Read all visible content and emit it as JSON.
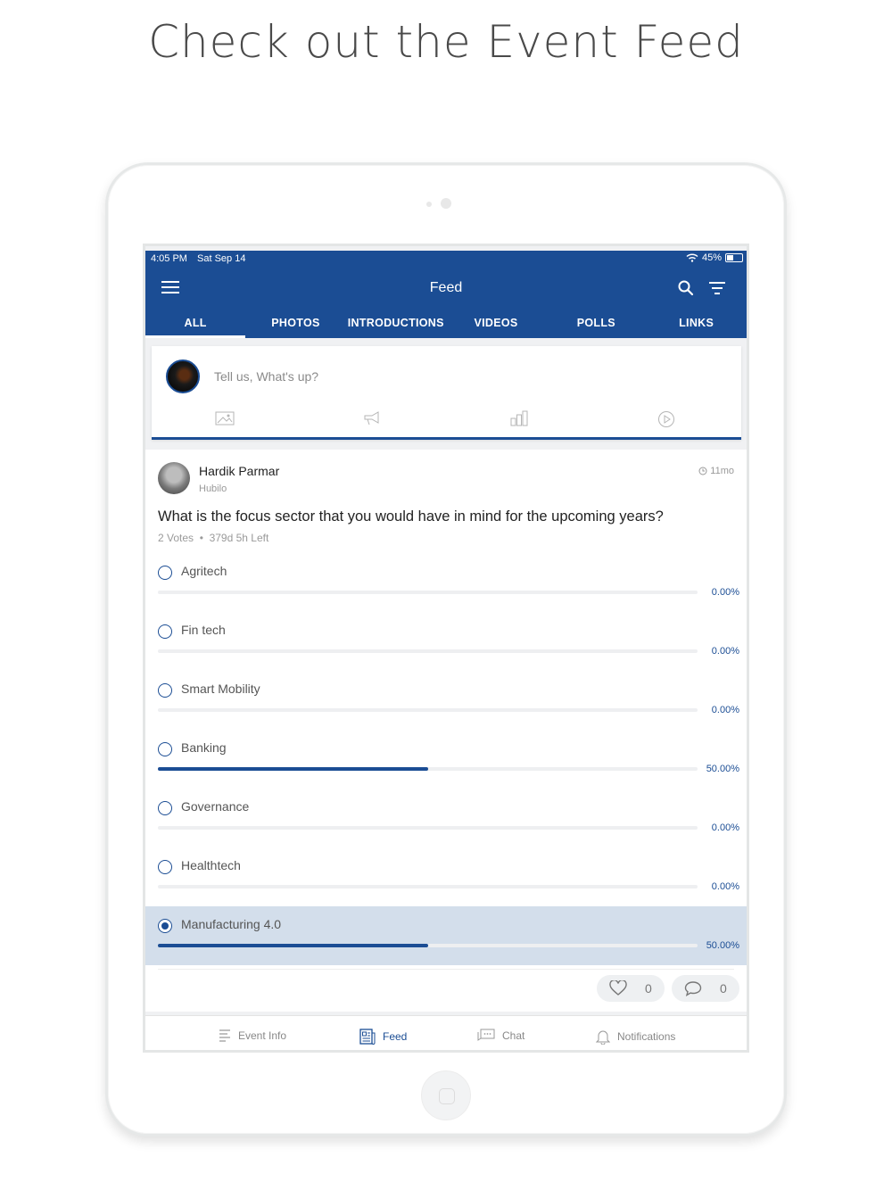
{
  "headline": "Check out the Event Feed",
  "status_bar": {
    "time": "4:05 PM",
    "date": "Sat Sep 14",
    "battery": "45%"
  },
  "header": {
    "title": "Feed"
  },
  "tabs": [
    {
      "label": "ALL",
      "active": true
    },
    {
      "label": "PHOTOS",
      "active": false
    },
    {
      "label": "INTRODUCTIONS",
      "active": false
    },
    {
      "label": "VIDEOS",
      "active": false
    },
    {
      "label": "POLLS",
      "active": false
    },
    {
      "label": "LINKS",
      "active": false
    }
  ],
  "composer": {
    "placeholder": "Tell us, What's up?",
    "actions": [
      "image-icon",
      "megaphone-icon",
      "poll-icon",
      "video-play-icon"
    ]
  },
  "post": {
    "author": "Hardik Parmar",
    "organization": "Hubilo",
    "time_ago": "11mo",
    "question": "What is the focus sector that you would have in mind for the upcoming years?",
    "votes": "2 Votes",
    "time_left": "379d 5h Left",
    "options": [
      {
        "label": "Agritech",
        "percent_label": "0.00%",
        "percent": 0,
        "selected": false
      },
      {
        "label": "Fin tech",
        "percent_label": "0.00%",
        "percent": 0,
        "selected": false
      },
      {
        "label": "Smart Mobility",
        "percent_label": "0.00%",
        "percent": 0,
        "selected": false
      },
      {
        "label": "Banking",
        "percent_label": "50.00%",
        "percent": 50,
        "selected": false
      },
      {
        "label": "Governance",
        "percent_label": "0.00%",
        "percent": 0,
        "selected": false
      },
      {
        "label": "Healthtech",
        "percent_label": "0.00%",
        "percent": 0,
        "selected": false
      },
      {
        "label": "Manufacturing 4.0",
        "percent_label": "50.00%",
        "percent": 50,
        "selected": true
      }
    ],
    "likes": "0",
    "comments": "0"
  },
  "bottom_nav": [
    {
      "label": "Event Info",
      "icon": "event-info-icon",
      "active": false
    },
    {
      "label": "Feed",
      "icon": "feed-icon",
      "active": true
    },
    {
      "label": "Chat",
      "icon": "chat-icon",
      "active": false
    },
    {
      "label": "Notifications",
      "icon": "bell-icon",
      "active": false
    }
  ],
  "colors": {
    "brand": "#1b4d94",
    "selected_row": "#d3deeb"
  }
}
